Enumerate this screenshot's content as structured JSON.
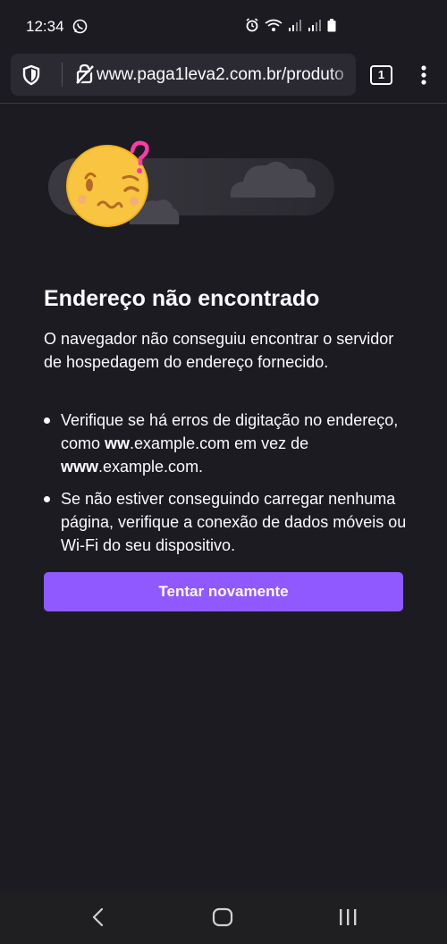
{
  "status_bar": {
    "time": "12:34",
    "icons": [
      "whatsapp-icon",
      "alarm-icon",
      "wifi-icon",
      "signal-icon",
      "signal-icon",
      "battery-icon"
    ]
  },
  "toolbar": {
    "url": "www.paga1leva2.com.br/produto",
    "tab_count": "1",
    "icons": [
      "shield-icon",
      "insecure-connection-icon",
      "menu-icon"
    ]
  },
  "error": {
    "title": "Endereço não encontrado",
    "description": "O navegador não conseguiu encontrar o servidor de hospedagem do endereço fornecido.",
    "tips": [
      {
        "before": "Verifique se há erros de digitação no endereço, como ",
        "bold1": "ww",
        "middle": ".example.com em vez de ",
        "bold2": "www",
        "after": ".example.com."
      },
      {
        "text": "Se não estiver conseguindo carregar nenhuma página, verifique a conexão de dados móveis ou Wi-Fi do seu dispositivo."
      }
    ],
    "retry_label": "Tentar novamente"
  },
  "colors": {
    "background": "#1c1b22",
    "url_field": "#2b2a33",
    "accent": "#9059ff",
    "text": "#fbfbfe"
  },
  "nav_bar": {
    "icons": [
      "back-icon",
      "home-icon",
      "recents-icon"
    ]
  }
}
